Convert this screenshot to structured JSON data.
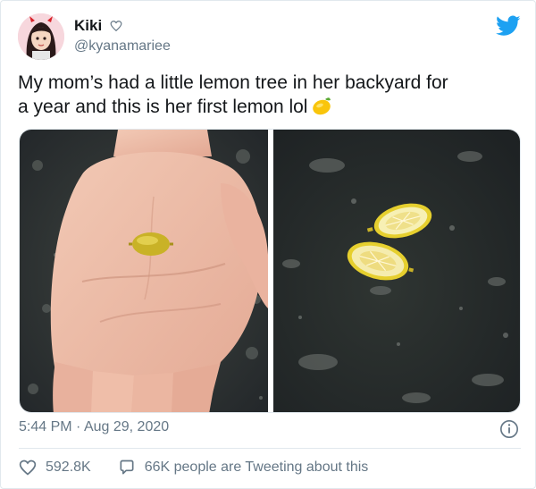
{
  "user": {
    "display_name": "Kiki",
    "handle": "@kyanamariee",
    "verified_badge_icon": "heart-outline-icon",
    "avatar_icon": "avatar-illustration"
  },
  "brand": {
    "icon": "twitter-bird-icon",
    "color": "#1da1f2"
  },
  "tweet": {
    "text_line1": "My mom’s had a little lemon tree in her backyard for",
    "text_line2": "a year and this is her first lemon lol",
    "emoji": "lemon-emoji"
  },
  "media": {
    "left_photo": "hand-holding-tiny-lemon",
    "right_photo": "tiny-lemon-cut-in-half-on-granite"
  },
  "meta": {
    "time": "5:44 PM",
    "separator": "·",
    "date": "Aug 29, 2020",
    "info_icon": "info-icon"
  },
  "actions": {
    "likes": "592.8K",
    "like_icon": "heart-outline-icon",
    "tweeting_text": "66K people are Tweeting about this",
    "reply_icon": "speech-bubble-icon"
  },
  "colors": {
    "text": "#14171a",
    "muted": "#657786",
    "border": "#e1e8ed"
  }
}
